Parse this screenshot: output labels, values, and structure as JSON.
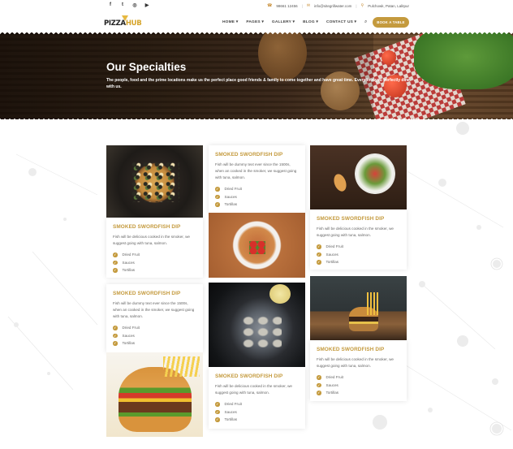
{
  "social": {
    "icons": [
      "facebook-icon",
      "twitter-icon",
      "instagram-icon",
      "youtube-icon"
    ],
    "glyphs": [
      "f",
      "t",
      "◎",
      "▶"
    ]
  },
  "contact": {
    "phone": "98661 12456",
    "email": "info@sitegrillwater.com",
    "address": "Pulchowk, Patan, Lalitpur"
  },
  "logo": {
    "part1": "PIZZA",
    "part2": "HUB"
  },
  "nav": {
    "items": [
      "HOME ▾",
      "PAGES ▾",
      "GALLERY ▾",
      "BLOG ▾",
      "CONTACT US ▾"
    ],
    "book_label": "BOOK A TABLE"
  },
  "hero": {
    "title": "Our Specialties",
    "text": "The people, food and the prime locations make us the perfect place good friends & family to come together and have great time. Everytime you perfectly dine with us."
  },
  "cards": [
    {
      "title": "SMOKED SWORDFISH DIP",
      "text": "Fish will be delicious cooked in the smoker, we suggest going with tuna, salmon.",
      "items": [
        "Dried Fruit",
        "Sauces",
        "Tortillas"
      ]
    },
    {
      "title": "SMOKED SWORDFISH DIP",
      "text": "Fish will be dummy text ever since the 1500s, when an cooked in the smoker, we suggest going with tuna, salmon.",
      "items": [
        "Dried Fruit",
        "Sauces",
        "Tortillas"
      ]
    },
    {
      "title": "SMOKED SWORDFISH DIP",
      "text": "Fish will be dummy text ever since the 1500s, when an cooked in the smoker, we suggest going with tuna, salmon.",
      "items": [
        "Dried Fruit",
        "Sauces",
        "Tortillas"
      ]
    },
    {
      "title": "SMOKED SWORDFISH DIP",
      "text": "Fish will be delicious cooked in the smoker, we suggest going with tuna, salmon.",
      "items": [
        "Dried Fruit",
        "Sauces",
        "Tortillas"
      ]
    },
    {
      "title": "SMOKED SWORDFISH DIP",
      "text": "Fish will be delicious cooked in the smoker, we suggest going with tuna, salmon.",
      "items": [
        "Dried Fruit",
        "Sauces",
        "Tortillas"
      ]
    },
    {
      "title": "SMOKED SWORDFISH DIP",
      "text": "Fish will be delicious cooked in the smoker, we suggest going with tuna, salmon.",
      "items": [
        "Dried Fruit",
        "Sauces",
        "Tortillas"
      ]
    }
  ],
  "colors": {
    "accent": "#c49a3d",
    "text": "#666666"
  }
}
